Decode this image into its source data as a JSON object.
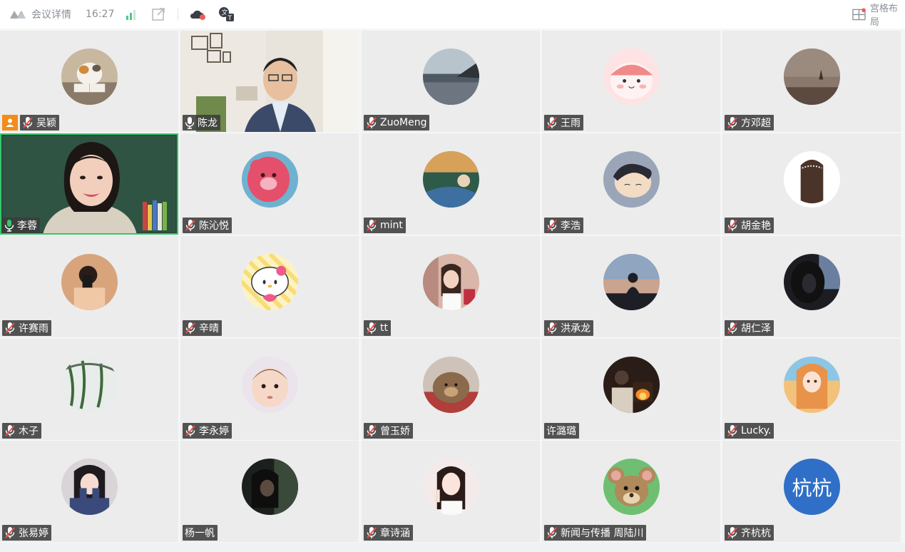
{
  "topbar": {
    "meeting_details": "会议详情",
    "time": "16:27",
    "layout_label": "宫格布局"
  },
  "colors": {
    "accent_green": "#35c76a",
    "host_orange": "#f28c1a",
    "tile_bg": "#ececec",
    "label_bg": "#3c3c3c"
  },
  "participants": [
    {
      "name": "吴颖",
      "mic": "muted",
      "host": true,
      "avatar": "cat-reading-photo"
    },
    {
      "name": "陈龙",
      "mic": "on",
      "video": true,
      "avatar": "man-glasses-video"
    },
    {
      "name": "ZuoMeng",
      "mic": "muted",
      "avatar": "seaside-photo"
    },
    {
      "name": "王雨",
      "mic": "muted",
      "avatar": "pink-cartoon"
    },
    {
      "name": "方邓超",
      "mic": "muted",
      "avatar": "sunset-field-photo"
    },
    {
      "name": "李蓉",
      "mic": "active",
      "video": true,
      "speaking": true,
      "avatar": "woman-blackboard-video"
    },
    {
      "name": "陈沁悦",
      "mic": "muted",
      "avatar": "pink-bear-toy"
    },
    {
      "name": "mint",
      "mic": "muted",
      "avatar": "anime-scene"
    },
    {
      "name": "李浩",
      "mic": "muted",
      "avatar": "anime-sleeping-boy"
    },
    {
      "name": "胡金艳",
      "mic": "muted",
      "avatar": "girl-hair-drawing"
    },
    {
      "name": "许赛雨",
      "mic": "muted",
      "avatar": "mirror-selfie"
    },
    {
      "name": "辛晴",
      "mic": "muted",
      "avatar": "hello-kitty"
    },
    {
      "name": "tt",
      "mic": "muted",
      "avatar": "girl-selfie"
    },
    {
      "name": "洪承龙",
      "mic": "muted",
      "avatar": "silhouette-sunset"
    },
    {
      "name": "胡仁泽",
      "mic": "muted",
      "avatar": "dark-sunset-portrait"
    },
    {
      "name": "木子",
      "mic": "muted",
      "avatar": "plants-wall"
    },
    {
      "name": "李永婷",
      "mic": "muted",
      "avatar": "baby-face"
    },
    {
      "name": "曾玉娇",
      "mic": "muted",
      "avatar": "bear-plush"
    },
    {
      "name": "许潞璐",
      "mic": "none",
      "avatar": "fireplace-girl"
    },
    {
      "name": "Lucky.",
      "mic": "muted",
      "avatar": "anime-girl-field"
    },
    {
      "name": "张易婷",
      "mic": "muted",
      "avatar": "girl-sweater"
    },
    {
      "name": "杨一帆",
      "mic": "none",
      "avatar": "dark-hair-portrait"
    },
    {
      "name": "章诗涵",
      "mic": "muted",
      "avatar": "girl-peace-sign"
    },
    {
      "name": "新闻与传播 周陆川",
      "mic": "muted",
      "avatar": "jerry-cartoon"
    },
    {
      "name": "齐杭杭",
      "mic": "muted",
      "avatar": "text-avatar",
      "avatar_text": "杭杭",
      "avatar_color": "#2f6fc7"
    }
  ]
}
